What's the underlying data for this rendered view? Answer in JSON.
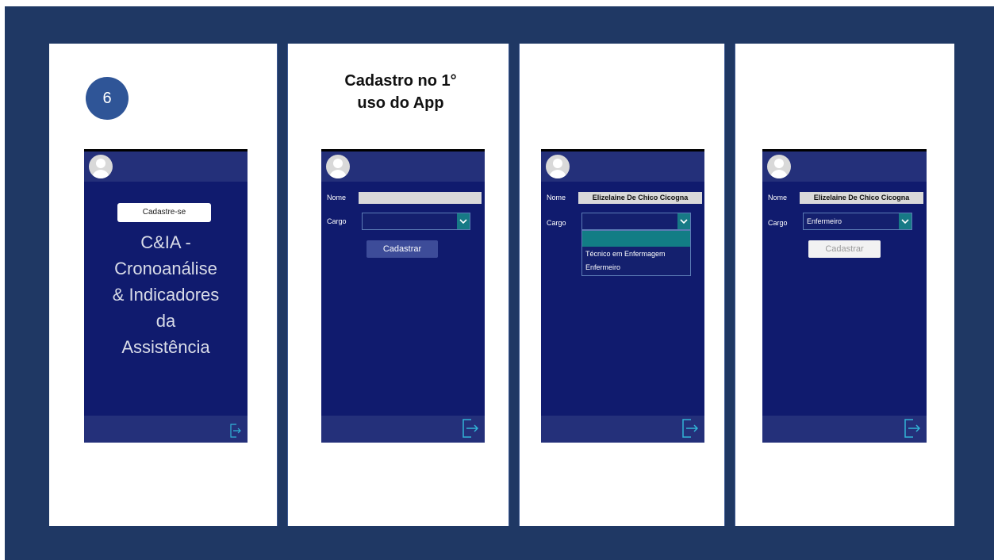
{
  "step_number": "6",
  "heading": {
    "line1": "Cadastro no 1°",
    "line2": "uso do App"
  },
  "screen1": {
    "signup_label": "Cadastre-se",
    "title_lines": [
      "C&IA -",
      "Cronoanálise",
      "& Indicadores",
      "da",
      "Assistência"
    ]
  },
  "screen2": {
    "name_label": "Nome",
    "name_value": "",
    "role_label": "Cargo",
    "role_value": "",
    "submit_label": "Cadastrar"
  },
  "screen3": {
    "name_label": "Nome",
    "name_value": "Elizelaine De Chico Cicogna",
    "role_label": "Cargo",
    "role_value": "",
    "options": [
      "Técnico em Enfermagem",
      "Enfermeiro"
    ]
  },
  "screen4": {
    "name_label": "Nome",
    "name_value": "Elizelaine De Chico Cicogna",
    "role_label": "Cargo",
    "role_value": "Enfermeiro",
    "submit_label": "Cadastrar"
  },
  "colors": {
    "slide_bg": "#1f3864",
    "phone_bg": "#101b6e",
    "phone_bar": "#24307a",
    "accent_teal": "#177a86",
    "step_circle": "#2f5597"
  },
  "icons": [
    "user-avatar-icon",
    "exit-icon",
    "chevron-down-icon"
  ]
}
